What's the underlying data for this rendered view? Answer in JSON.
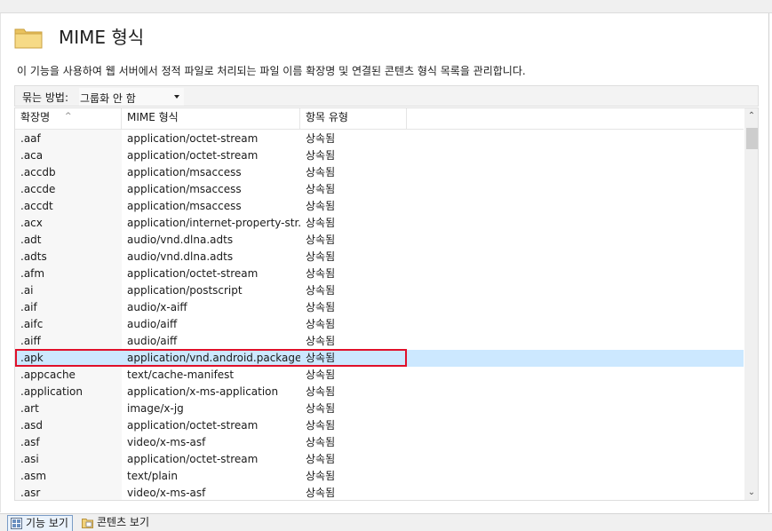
{
  "page": {
    "title": "MIME 형식",
    "description": "이 기능을 사용하여 웹 서버에서 정적 파일로 처리되는 파일 이름 확장명 및 연결된 콘텐츠 형식 목록을 관리합니다."
  },
  "toolbar": {
    "group_label": "묶는 방법:",
    "group_value": "그룹화 안 함"
  },
  "table": {
    "columns": [
      "확장명",
      "MIME 형식",
      "항목 유형"
    ],
    "selected_index": 13,
    "rows": [
      [
        ".aaf",
        "application/octet-stream",
        "상속됨"
      ],
      [
        ".aca",
        "application/octet-stream",
        "상속됨"
      ],
      [
        ".accdb",
        "application/msaccess",
        "상속됨"
      ],
      [
        ".accde",
        "application/msaccess",
        "상속됨"
      ],
      [
        ".accdt",
        "application/msaccess",
        "상속됨"
      ],
      [
        ".acx",
        "application/internet-property-str...",
        "상속됨"
      ],
      [
        ".adt",
        "audio/vnd.dlna.adts",
        "상속됨"
      ],
      [
        ".adts",
        "audio/vnd.dlna.adts",
        "상속됨"
      ],
      [
        ".afm",
        "application/octet-stream",
        "상속됨"
      ],
      [
        ".ai",
        "application/postscript",
        "상속됨"
      ],
      [
        ".aif",
        "audio/x-aiff",
        "상속됨"
      ],
      [
        ".aifc",
        "audio/aiff",
        "상속됨"
      ],
      [
        ".aiff",
        "audio/aiff",
        "상속됨"
      ],
      [
        ".apk",
        "application/vnd.android.package...",
        "상속됨"
      ],
      [
        ".appcache",
        "text/cache-manifest",
        "상속됨"
      ],
      [
        ".application",
        "application/x-ms-application",
        "상속됨"
      ],
      [
        ".art",
        "image/x-jg",
        "상속됨"
      ],
      [
        ".asd",
        "application/octet-stream",
        "상속됨"
      ],
      [
        ".asf",
        "video/x-ms-asf",
        "상속됨"
      ],
      [
        ".asi",
        "application/octet-stream",
        "상속됨"
      ],
      [
        ".asm",
        "text/plain",
        "상속됨"
      ],
      [
        ".asr",
        "video/x-ms-asf",
        "상속됨"
      ]
    ]
  },
  "bottom_tabs": {
    "features_view": "기능 보기",
    "content_view": "콘텐츠 보기"
  },
  "colors": {
    "selection": "#cce8ff",
    "highlight_border": "#e0102a",
    "folder": "#f2d27a"
  },
  "icons": {
    "title": "folder-icon",
    "scroll_up": "chevron-up-icon",
    "scroll_down": "chevron-down-icon"
  }
}
